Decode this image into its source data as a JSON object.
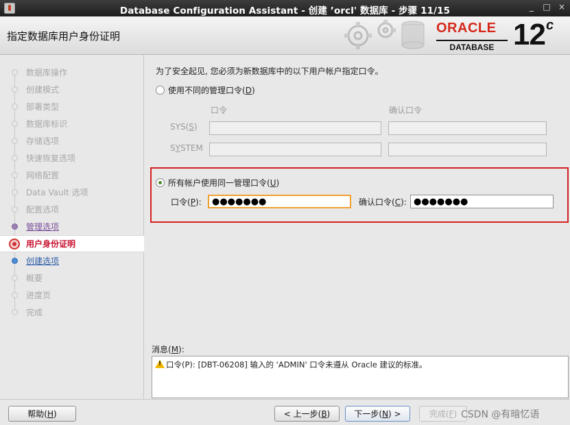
{
  "window": {
    "title": "Database Configuration Assistant - 创建 ’orcl' 数据库 - 步骤 11/15",
    "controls": [
      "_",
      "□",
      "×"
    ]
  },
  "header": {
    "page_title": "指定数据库用户身份证明",
    "brand": "ORACLE",
    "brand_sub": "DATABASE",
    "version": "12",
    "version_suffix": "c",
    "brand_color": "#d5281b"
  },
  "sidebar": {
    "steps": [
      {
        "label": "数据库操作",
        "state": "done"
      },
      {
        "label": "创建模式",
        "state": "done"
      },
      {
        "label": "部署类型",
        "state": "done"
      },
      {
        "label": "数据库标识",
        "state": "done"
      },
      {
        "label": "存储选项",
        "state": "done"
      },
      {
        "label": "快速恢复选项",
        "state": "done"
      },
      {
        "label": "网络配置",
        "state": "done"
      },
      {
        "label": "Data Vault 选项",
        "state": "done"
      },
      {
        "label": "配置选项",
        "state": "done"
      },
      {
        "label": "管理选项",
        "state": "visited"
      },
      {
        "label": "用户身份证明",
        "state": "current"
      },
      {
        "label": "创建选项",
        "state": "next"
      },
      {
        "label": "概要",
        "state": "todo"
      },
      {
        "label": "进度页",
        "state": "todo"
      },
      {
        "label": "完成",
        "state": "todo"
      }
    ]
  },
  "main": {
    "intro": "为了安全起见, 您必须为新数据库中的以下用户帐户指定口令。",
    "option_diff": {
      "text": "使用不同的管理口令(",
      "key": "D",
      "tail": ")",
      "selected": false
    },
    "col_password": "口令",
    "col_confirm": "确认口令",
    "row_sys": {
      "text": "SYS(",
      "key": "S",
      "tail": ")"
    },
    "row_system": {
      "text": "S",
      "key": "Y",
      "tail": "STEM"
    },
    "option_same": {
      "text": "所有帐户使用同一管理口令(",
      "key": "U",
      "tail": ")",
      "selected": true
    },
    "password_label": {
      "text": "口令(",
      "key": "P",
      "tail": "):"
    },
    "password_value": "●●●●●●●",
    "confirm_label": {
      "text": "确认口令(",
      "key": "C",
      "tail": "):"
    },
    "confirm_value": "●●●●●●●",
    "messages_label": {
      "text": "消息(",
      "key": "M",
      "tail": "):"
    },
    "message_text": "口令(P): [DBT-06208] 输入的 'ADMIN' 口令未遵从 Oracle 建议的标准。",
    "warn_color": "#f0b800"
  },
  "footer": {
    "help": {
      "text": "帮助(",
      "key": "H",
      "tail": ")"
    },
    "back": {
      "text": "< 上一步(",
      "key": "B",
      "tail": ")"
    },
    "next": {
      "text": "下一步(",
      "key": "N",
      "tail": ") >"
    },
    "finish": {
      "text": "完成(",
      "key": "F",
      "tail": ")"
    },
    "watermark": "CSDN @有暗忆语"
  }
}
